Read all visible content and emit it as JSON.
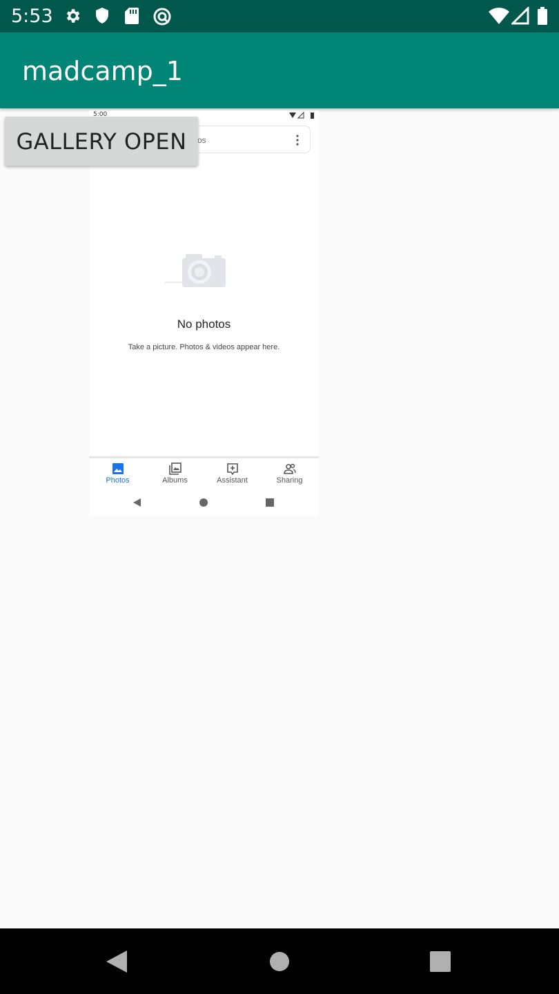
{
  "status_bar": {
    "time": "5:53",
    "icons": [
      "gear-icon",
      "shield-icon",
      "sd-card-icon",
      "sync-icon",
      "wifi-icon",
      "signal-icon",
      "battery-icon"
    ]
  },
  "app_bar": {
    "title": "madcamp_1"
  },
  "gallery_button": {
    "label": "GALLERY OPEN"
  },
  "embedded_screenshot": {
    "status_time": "5:00",
    "search_placeholder": "os",
    "empty_title": "No photos",
    "empty_subtitle": "Take a picture. Photos & videos appear here.",
    "bottom_nav": [
      {
        "label": "Photos",
        "icon": "photos-icon",
        "active": true
      },
      {
        "label": "Albums",
        "icon": "albums-icon",
        "active": false
      },
      {
        "label": "Assistant",
        "icon": "assistant-icon",
        "active": false
      },
      {
        "label": "Sharing",
        "icon": "sharing-icon",
        "active": false
      }
    ]
  },
  "colors": {
    "status_bar": "#00574b",
    "app_bar": "#008577",
    "background": "#fafafa",
    "button": "#d6d7d7",
    "active_tab": "#1a73e8"
  }
}
